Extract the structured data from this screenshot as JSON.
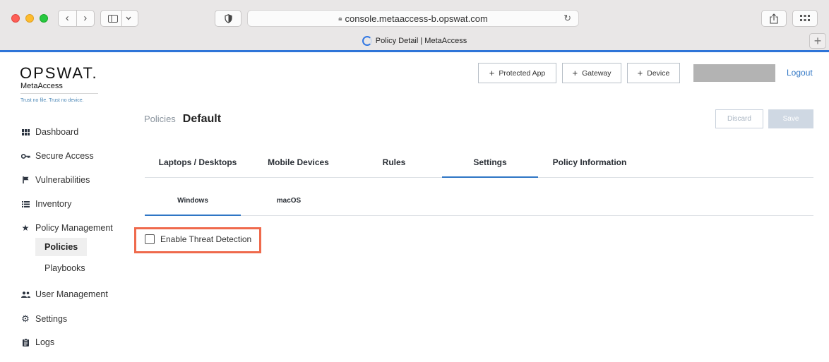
{
  "browser": {
    "url": "console.metaaccess-b.opswat.com",
    "tab_title": "Policy Detail | MetaAccess",
    "back_glyph": "‹",
    "forward_glyph": "›",
    "new_tab_glyph": "+",
    "icons": [
      "back-icon",
      "forward-icon",
      "sidebar-icon",
      "shield-icon",
      "lock-icon",
      "reload-icon",
      "share-icon",
      "tab-overview-icon",
      "loading-spinner-icon"
    ]
  },
  "brand": {
    "logo": "OPSWAT.",
    "product": "MetaAccess",
    "tagline": "Trust no file. Trust no device."
  },
  "header": {
    "buttons": [
      {
        "label": "Protected App",
        "icon": "plus-icon"
      },
      {
        "label": "Gateway",
        "icon": "plus-icon"
      },
      {
        "label": "Device",
        "icon": "plus-icon"
      }
    ],
    "logout": "Logout"
  },
  "sidebar": {
    "items": [
      {
        "label": "Dashboard",
        "icon": "dashboard-icon"
      },
      {
        "label": "Secure Access",
        "icon": "key-icon"
      },
      {
        "label": "Vulnerabilities",
        "icon": "flag-icon"
      },
      {
        "label": "Inventory",
        "icon": "list-icon"
      },
      {
        "label": "Policy Management",
        "icon": "star-icon"
      },
      {
        "label": "User Management",
        "icon": "users-icon"
      },
      {
        "label": "Settings",
        "icon": "gear-icon"
      },
      {
        "label": "Logs",
        "icon": "clipboard-icon"
      }
    ],
    "subitems": [
      {
        "label": "Policies",
        "active": true
      },
      {
        "label": "Playbooks",
        "active": false
      }
    ]
  },
  "page": {
    "breadcrumb_parent": "Policies",
    "title": "Default",
    "discard": "Discard",
    "save": "Save"
  },
  "tabs": [
    {
      "label": "Laptops / Desktops",
      "active": false
    },
    {
      "label": "Mobile Devices",
      "active": false
    },
    {
      "label": "Rules",
      "active": false
    },
    {
      "label": "Settings",
      "active": true
    },
    {
      "label": "Policy Information",
      "active": false
    }
  ],
  "subtabs": [
    {
      "label": "Windows",
      "active": true
    },
    {
      "label": "macOS",
      "active": false
    }
  ],
  "option": {
    "label": "Enable Threat Detection",
    "checked": false
  },
  "colors": {
    "accent": "#2f76c5",
    "highlight": "#ef6a4c",
    "chrome_accent": "#2e74d8"
  }
}
